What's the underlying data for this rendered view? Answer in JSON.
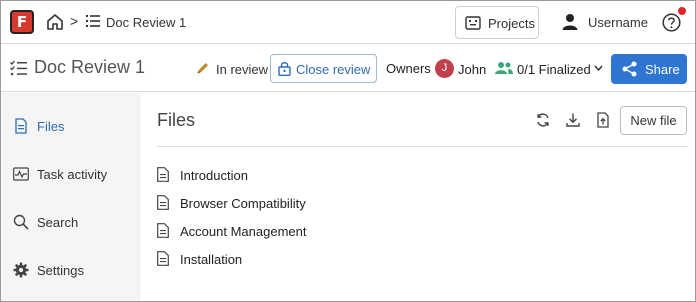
{
  "app": {
    "logo_letter": "F",
    "breadcrumb_title": "Doc Review 1",
    "projects_label": "Projects",
    "username": "Username"
  },
  "doc": {
    "title": "Doc Review 1",
    "status": "In review",
    "close_review_label": "Close review",
    "owners_label": "Owners",
    "owner_initial": "J",
    "owner_name": "John",
    "finalized_label": "0/1 Finalized",
    "share_label": "Share"
  },
  "sidebar": {
    "items": [
      {
        "label": "Files",
        "icon": "file-icon",
        "active": true
      },
      {
        "label": "Task activity",
        "icon": "activity-icon",
        "active": false
      },
      {
        "label": "Search",
        "icon": "search-icon",
        "active": false
      },
      {
        "label": "Settings",
        "icon": "gear-icon",
        "active": false
      }
    ]
  },
  "main": {
    "title": "Files",
    "new_file_label": "New file",
    "files": [
      {
        "name": "Introduction"
      },
      {
        "name": "Browser Compatibility"
      },
      {
        "name": "Account Management"
      },
      {
        "name": "Installation"
      }
    ]
  },
  "colors": {
    "accent": "#2f76d2",
    "logo": "#d63a2f",
    "notification": "#e0262c",
    "avatar": "#c0404d",
    "group_icon": "#3aa776"
  }
}
